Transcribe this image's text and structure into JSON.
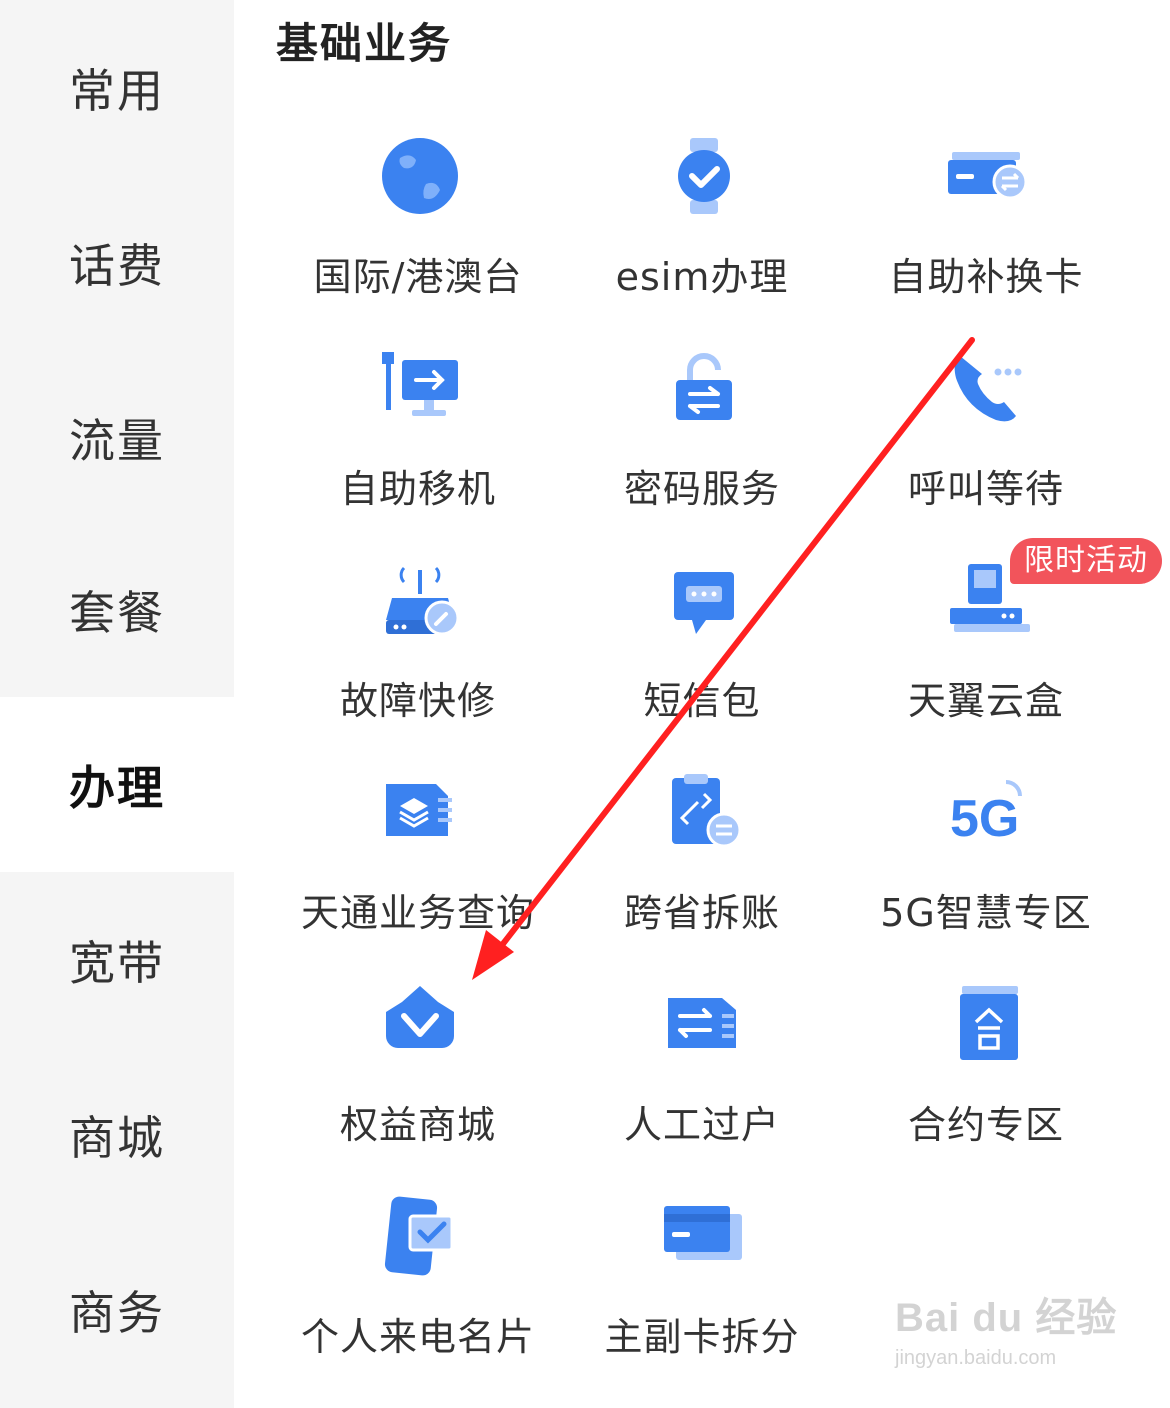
{
  "sidebar": {
    "items": [
      {
        "label": "常用"
      },
      {
        "label": "话费"
      },
      {
        "label": "流量"
      },
      {
        "label": "套餐"
      },
      {
        "label": "办理",
        "active": true
      },
      {
        "label": "宽带"
      },
      {
        "label": "商城"
      },
      {
        "label": "商务"
      }
    ]
  },
  "section": {
    "title": "基础业务",
    "items": [
      {
        "label": "国际/港澳台",
        "icon": "globe-icon"
      },
      {
        "label": "esim办理",
        "icon": "smartwatch-check-icon"
      },
      {
        "label": "自助补换卡",
        "icon": "card-exchange-icon"
      },
      {
        "label": "自助移机",
        "icon": "monitor-transfer-icon"
      },
      {
        "label": "密码服务",
        "icon": "unlock-icon"
      },
      {
        "label": "呼叫等待",
        "icon": "phone-wait-icon"
      },
      {
        "label": "故障快修",
        "icon": "router-repair-icon"
      },
      {
        "label": "短信包",
        "icon": "sms-icon"
      },
      {
        "label": "天翼云盒",
        "icon": "tv-box-icon",
        "badge": "限时活动"
      },
      {
        "label": "天通业务查询",
        "icon": "sim-layers-icon"
      },
      {
        "label": "跨省拆账",
        "icon": "clipboard-link-icon"
      },
      {
        "label": "5G智慧专区",
        "icon": "5g-icon"
      },
      {
        "label": "权益商城",
        "icon": "crown-v-icon"
      },
      {
        "label": "人工过户",
        "icon": "sim-transfer-icon"
      },
      {
        "label": "合约专区",
        "icon": "contract-book-icon"
      },
      {
        "label": "个人来电名片",
        "icon": "phone-card-icon"
      },
      {
        "label": "主副卡拆分",
        "icon": "cards-split-icon"
      }
    ]
  },
  "watermark": {
    "main": "Bai du 经验",
    "sub": "jingyan.baidu.com"
  },
  "colors": {
    "icon_blue": "#3b82f0",
    "icon_light": "#a9c8fb",
    "badge": "#f2545b",
    "arrow": "#ff2020"
  }
}
